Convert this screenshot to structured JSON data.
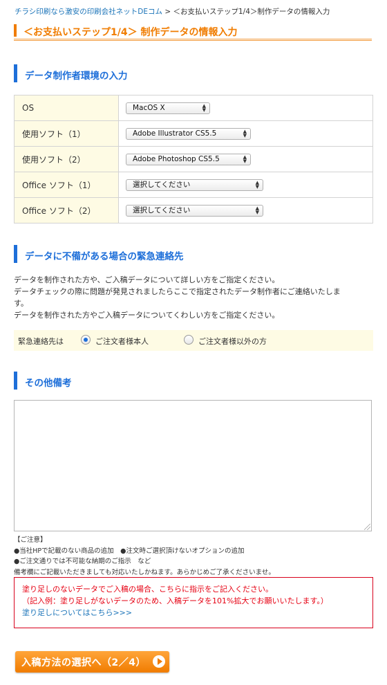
{
  "breadcrumb": {
    "home": "チラシ印刷なら激安の印刷会社ネットDEコム",
    "separator": " > ",
    "current": "＜お支払いステップ1/4＞制作データの情報入力"
  },
  "page_title": "＜お支払いステップ1/4＞ 制作データの情報入力",
  "env_section": {
    "heading": "データ制作者環境の入力",
    "rows": [
      {
        "label": "OS",
        "value": "MacOS X"
      },
      {
        "label": "使用ソフト（1）",
        "value": "Adobe Illustrator CS5.5"
      },
      {
        "label": "使用ソフト（2）",
        "value": "Adobe Photoshop CS5.5"
      },
      {
        "label": "Office ソフト（1）",
        "value": "選択してください"
      },
      {
        "label": "Office ソフト（2）",
        "value": "選択してください"
      }
    ]
  },
  "contact_section": {
    "heading": "データに不備がある場合の緊急連絡先",
    "text_1": "データを制作された方や、ご入稿データについて詳しい方をご指定ください。",
    "text_2a": "データチェックの際に問題が発見されましたらここで指定されたデータ制作者にご連絡いたしま",
    "text_2b": "す。",
    "text_3": "データを制作された方やご入稿データについてくわしい方をご指定ください。",
    "field_label": "緊急連絡先は",
    "option_1": "ご注文者様本人",
    "option_2": "ご注文者様以外の方",
    "selected": "ご注文者様本人"
  },
  "remarks_section": {
    "heading": "その他備考",
    "textarea_value": ""
  },
  "notes": {
    "title": "【ご注意】",
    "line_1": "●当社HPで記載のない商品の追加　●注文時ご選択頂けないオプションの追加",
    "line_2": "●ご注文通りでは不可能な納期のご指示　など",
    "line_3": "備考欄にご記載いただきましても対応いたしかねます。あらかじめご了承くださいませ。"
  },
  "warning": {
    "line_1": "塗り足しのないデータでご入稿の場合、こちらに指示をご記入ください。",
    "line_2": "（記入例：塗り足しがないデータのため、入稿データを101%拡大でお願いいたします。）",
    "link": "塗り足しについてはこちら>>>"
  },
  "next_button": "入稿方法の選択へ（2／4）",
  "colors": {
    "accent_orange": "#f07c00",
    "heading_blue": "#1e6fd9",
    "label_bg": "#fefbe4",
    "warning_red": "#e60012",
    "link_blue": "#1a73b8"
  }
}
